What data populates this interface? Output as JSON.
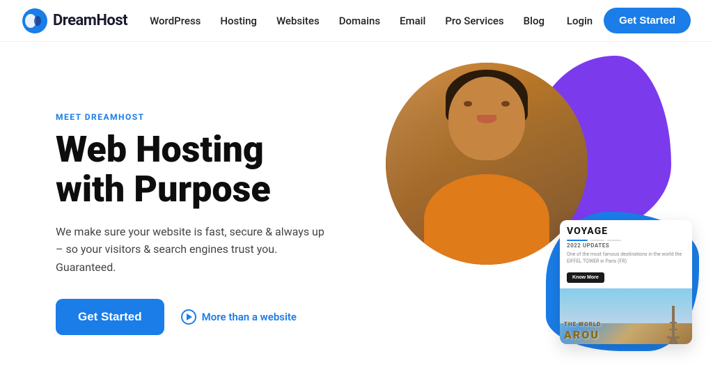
{
  "navbar": {
    "logo_text": "DreamHost",
    "links": [
      {
        "id": "wordpress",
        "label": "WordPress"
      },
      {
        "id": "hosting",
        "label": "Hosting"
      },
      {
        "id": "websites",
        "label": "Websites"
      },
      {
        "id": "domains",
        "label": "Domains"
      },
      {
        "id": "email",
        "label": "Email"
      },
      {
        "id": "pro-services",
        "label": "Pro Services"
      },
      {
        "id": "blog",
        "label": "Blog"
      }
    ],
    "login_label": "Login",
    "get_started_label": "Get Started"
  },
  "hero": {
    "meet_label": "MEET DREAMHOST",
    "title_line1": "Web Hosting",
    "title_line2": "with Purpose",
    "description": "We make sure your website is fast, secure & always up – so your visitors & search engines trust you. Guaranteed.",
    "get_started_label": "Get Started",
    "more_link_label": "More than a website"
  },
  "card": {
    "title": "VOYAGE",
    "meta": "2022 UPDATES",
    "text": "One of the most famous destinations in the world the EIFFEL TOWER in Paris (FR)",
    "button_label": "Know More",
    "image_label": "THE WORLD AROUND"
  },
  "colors": {
    "blue": "#1a7de8",
    "purple": "#7c3aed",
    "dark": "#0d0d0d"
  }
}
